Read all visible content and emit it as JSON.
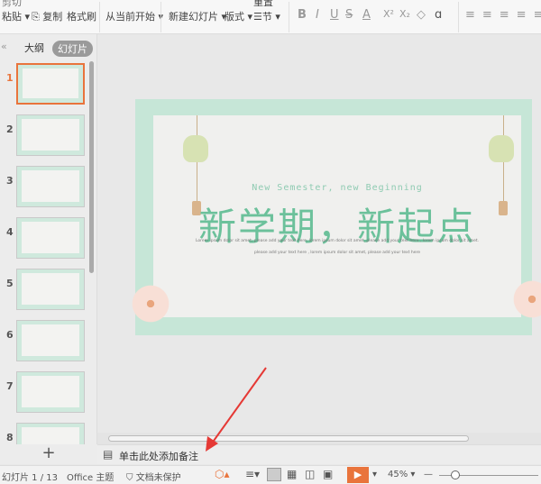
{
  "toolbar": {
    "paste": "粘贴",
    "copy": "复制",
    "format_painter": "格式刷",
    "from_current": "从当前开始",
    "new_slide": "新建幻灯片",
    "layout": "版式",
    "section": "节",
    "cut": "剪切",
    "reset": "重置"
  },
  "format": {
    "bold": "B",
    "italic": "I",
    "underline": "U",
    "strike": "S",
    "font_color": "A",
    "superscript": "X²",
    "subscript": "X₂",
    "clear": "◇",
    "text_effect": "ɑ"
  },
  "panel": {
    "outline_tab": "大纲",
    "slides_tab": "幻灯片",
    "add": "+",
    "thumbnails": [
      "1",
      "2",
      "3",
      "4",
      "5",
      "6",
      "7",
      "8"
    ]
  },
  "slide": {
    "subtitle": "New Semester, new Beginning",
    "title": "新学期，新起点",
    "body_line1": "Lorem ipsum dolor sit amet, please add your text here, lorem ipsum dolor sit amet, please add your text here , lorem ipsum dolor sit amet.",
    "body_line2": "please add your text here , lorem ipsum dolor sit amet, please add your text here"
  },
  "notes": {
    "placeholder": "单击此处添加备注"
  },
  "status": {
    "slide_counter": "幻灯片 1 / 13",
    "theme": "Office 主题",
    "protection": "文档未保护",
    "zoom": "45%"
  },
  "colors": {
    "accent": "#e9743c",
    "title_green": "#6cc19b",
    "arrow": "#e53935"
  }
}
